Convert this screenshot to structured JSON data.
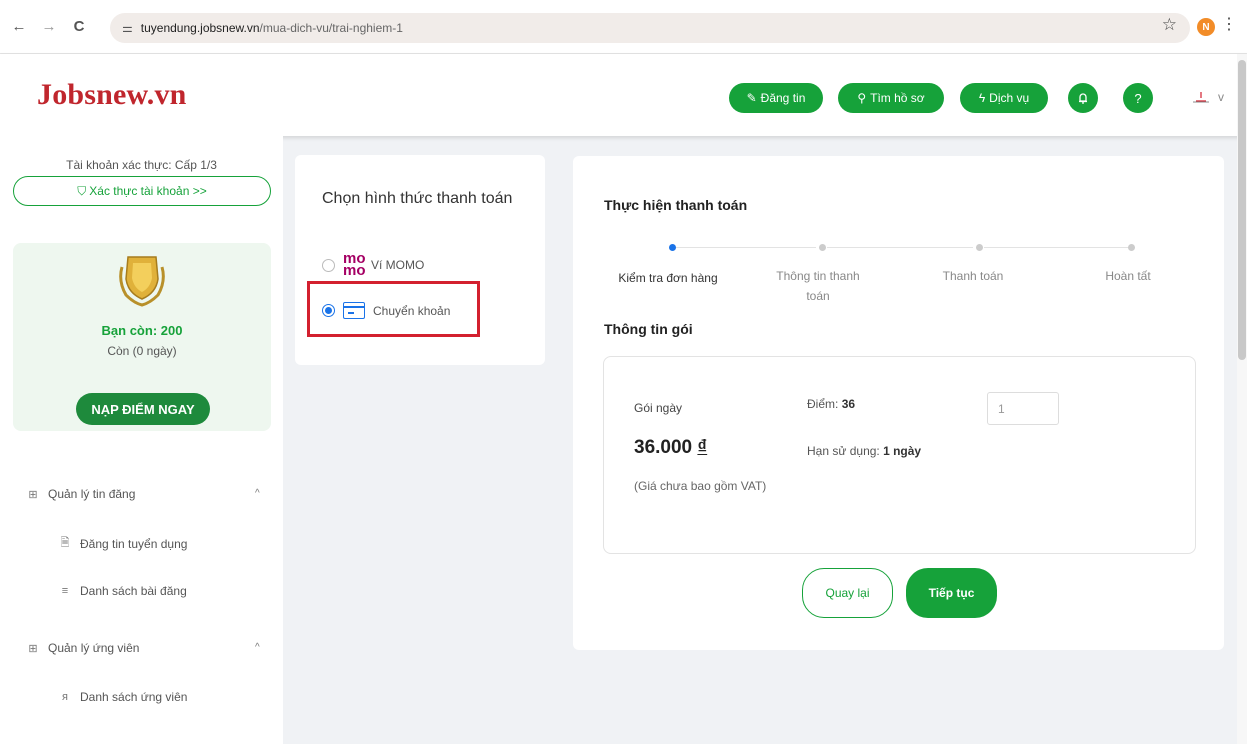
{
  "browser": {
    "back_icon": "←",
    "forward_icon": "→",
    "reload_icon": "C",
    "url_host": "tuyendung.jobsnew.vn",
    "url_path": "/mua-dich-vu/trai-nghiem-1",
    "profile_initial": "N"
  },
  "header": {
    "logo": "Jobsnew.vn",
    "post_job_label": "Đăng tin",
    "find_cv_label": "Tìm hồ sơ",
    "services_label": "Dịch vụ",
    "help_label": "?",
    "caret": "v"
  },
  "sidebar": {
    "verify_status": "Tài khoản xác thực: Cấp 1/3",
    "verify_button": "Xác thực tài khoản >>",
    "balance": "Bạn còn: 200",
    "remaining": "Còn (0 ngày)",
    "topup_button": "NẠP ĐIỂM NGAY",
    "menu": [
      {
        "label": "Quản lý tin đăng",
        "icon": "grid-icon",
        "caret": "^"
      },
      {
        "label": "Đăng tin tuyển dụng",
        "icon": "document-icon"
      },
      {
        "label": "Danh sách bài đăng",
        "icon": "list-icon"
      },
      {
        "label": "Quản lý ứng viên",
        "icon": "grid-icon",
        "caret": "^"
      },
      {
        "label": "Danh sách ứng viên",
        "icon": "person-icon"
      }
    ]
  },
  "payment_methods": {
    "title": "Chọn hình thức thanh toán",
    "options": [
      {
        "label": "Ví MOMO",
        "logo": "mo mo",
        "selected": false
      },
      {
        "label": "Chuyển khoản",
        "selected": true
      }
    ]
  },
  "checkout": {
    "title": "Thực hiện thanh toán",
    "steps": [
      {
        "label": "Kiểm tra đơn hàng",
        "active": true
      },
      {
        "label": "Thông tin thanh toán",
        "active": false
      },
      {
        "label": "Thanh toán",
        "active": false
      },
      {
        "label": "Hoàn tất",
        "active": false
      }
    ],
    "section_title": "Thông tin gói",
    "package": {
      "name": "Gói ngày",
      "price": "36.000",
      "currency": "₫",
      "vat_note": "(Giá chưa bao gồm VAT)",
      "points_label": "Điểm:",
      "points_value": "36",
      "expiry_label": "Hạn sử dụng:",
      "expiry_value": "1 ngày",
      "quantity": "1"
    },
    "back_button": "Quay lại",
    "next_button": "Tiếp tục"
  },
  "colors": {
    "brand_green": "#16a23a",
    "logo_red": "#c0262d",
    "highlight_red": "#d3202f",
    "active_blue": "#1a73e8",
    "momo_pink": "#a50064"
  }
}
